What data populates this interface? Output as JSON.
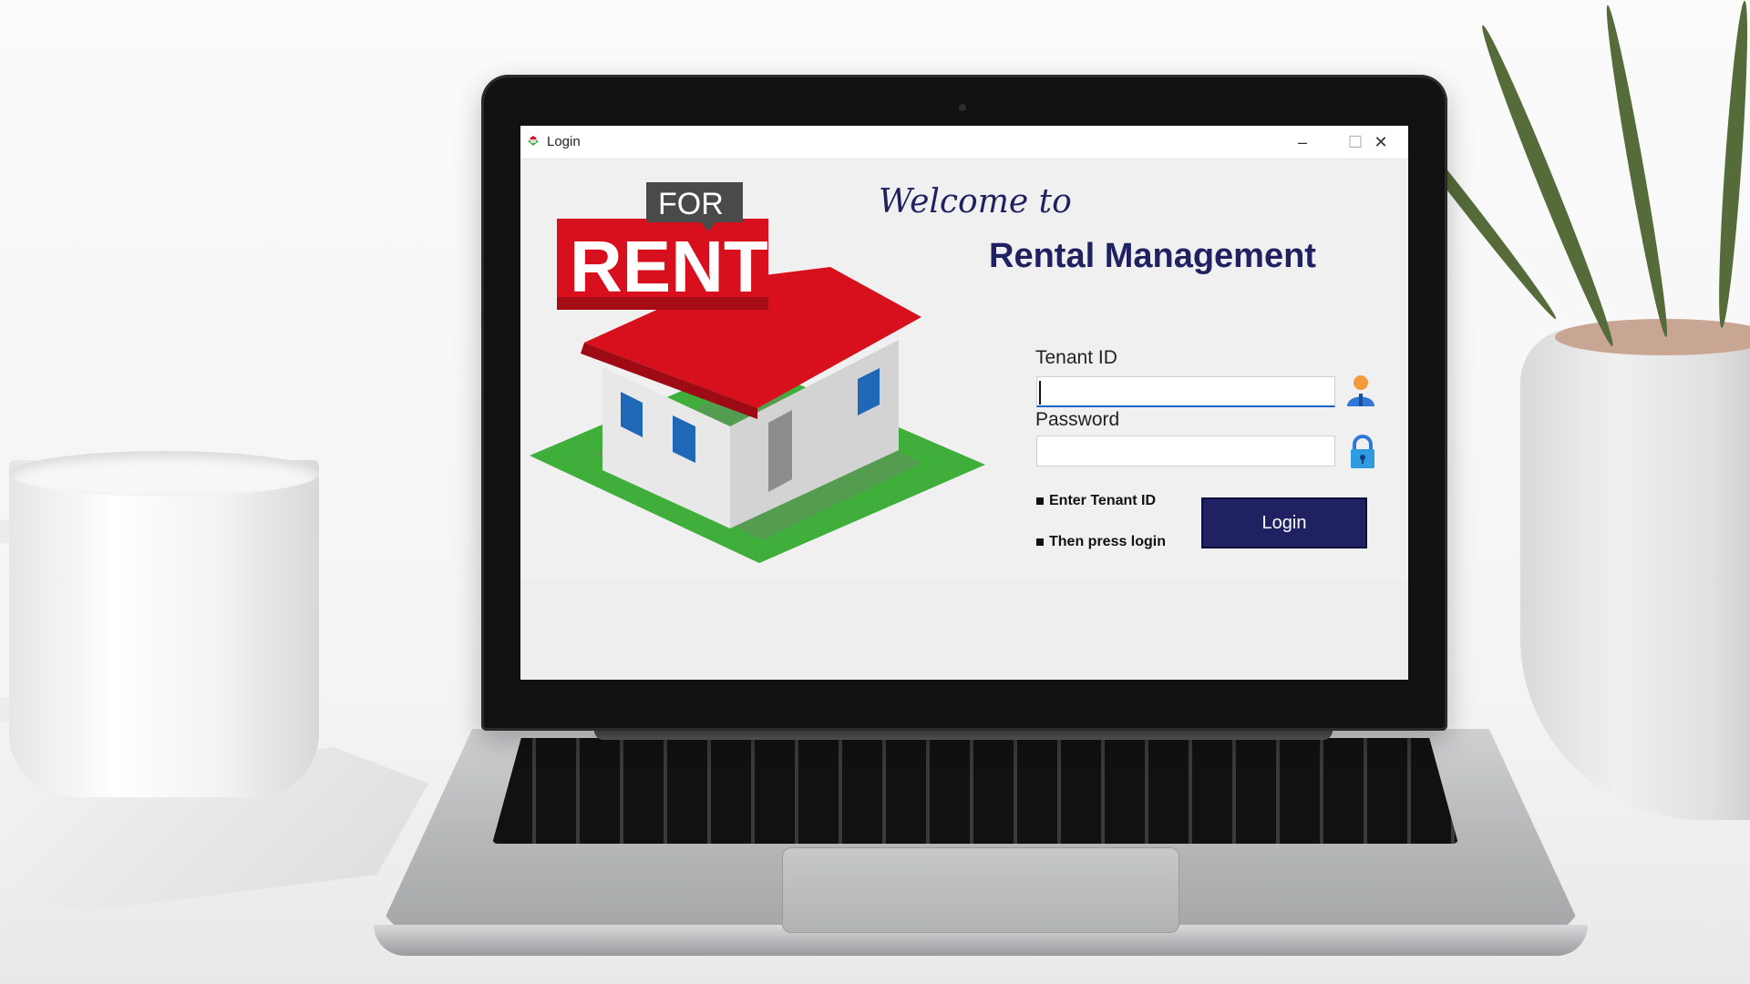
{
  "window": {
    "title": "Login",
    "controls": {
      "minimize": "–",
      "maximize": "☐",
      "close": "✕"
    }
  },
  "poster": {
    "for_text": "FOR",
    "rent_text": "RENT"
  },
  "header": {
    "welcome": "Welcome to",
    "app_name": "Rental Management"
  },
  "form": {
    "tenant_label": "Tenant ID",
    "tenant_value": "",
    "password_label": "Password",
    "password_value": "",
    "hints": [
      "Enter Tenant ID",
      "Then press login"
    ],
    "login_label": "Login"
  },
  "icons": {
    "tenant_field": "user-icon",
    "password_field": "lock-icon",
    "app": "app-icon"
  },
  "colors": {
    "brand_navy": "#1f2160",
    "rent_red": "#d8101e",
    "lawn_green": "#3fae3a",
    "field_focus": "#1e64c8",
    "window_bg": "#f0f0f0"
  }
}
